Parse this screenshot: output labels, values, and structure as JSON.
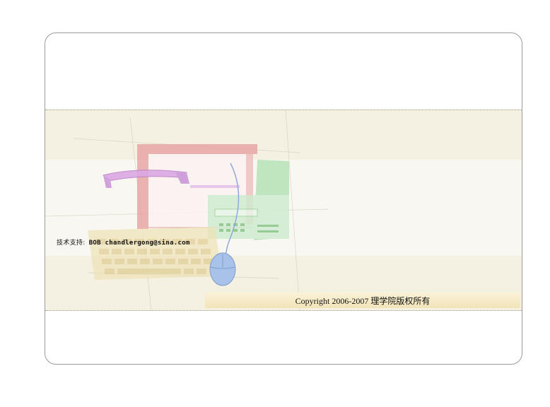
{
  "footer": {
    "support_label": "技术支持:",
    "support_value": "BOB chandlergong@sina.com",
    "copyright": "Copyright 2006-2007  理学院版权所有"
  },
  "colors": {
    "banner_bg": "#f4f0e2",
    "band_light": "#f9f7f1",
    "copyright_bar": "#f2e4b8",
    "monitor": "#e8a0a0",
    "fax": "#a8dfa8",
    "phone": "#d8a8e0",
    "keyboard": "#e8d8a8",
    "mouse": "#a8c0e8"
  },
  "illustration": {
    "items": [
      "monitor-icon",
      "phone-icon",
      "fax-icon",
      "keyboard-icon",
      "mouse-icon"
    ]
  }
}
